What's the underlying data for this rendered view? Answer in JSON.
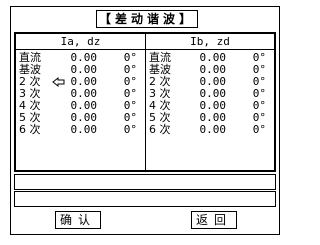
{
  "title": "【差动谐波】",
  "columns": {
    "left_header": "Ia, dz",
    "right_header": "Ib, zd"
  },
  "left_rows": [
    {
      "name": "直流",
      "value": "0.00",
      "angle": "0°"
    },
    {
      "name": "基波",
      "value": "0.00",
      "angle": "0°"
    },
    {
      "name": "2 次",
      "value": "0.00",
      "angle": "0°"
    },
    {
      "name": "3 次",
      "value": "0.00",
      "angle": "0°"
    },
    {
      "name": "4 次",
      "value": "0.00",
      "angle": "0°"
    },
    {
      "name": "5 次",
      "value": "0.00",
      "angle": "0°"
    },
    {
      "name": "6 次",
      "value": "0.00",
      "angle": "0°"
    }
  ],
  "right_rows": [
    {
      "name": "直流",
      "value": "0.00",
      "angle": "0°"
    },
    {
      "name": "基波",
      "value": "0.00",
      "angle": "0°"
    },
    {
      "name": "2 次",
      "value": "0.00",
      "angle": "0°"
    },
    {
      "name": "3 次",
      "value": "0.00",
      "angle": "0°"
    },
    {
      "name": "4 次",
      "value": "0.00",
      "angle": "0°"
    },
    {
      "name": "5 次",
      "value": "0.00",
      "angle": "0°"
    },
    {
      "name": "6 次",
      "value": "0.00",
      "angle": "0°"
    }
  ],
  "buttons": {
    "confirm": "确认",
    "back": "返回"
  },
  "icons": {
    "cursor": "hand-pointer-icon"
  }
}
